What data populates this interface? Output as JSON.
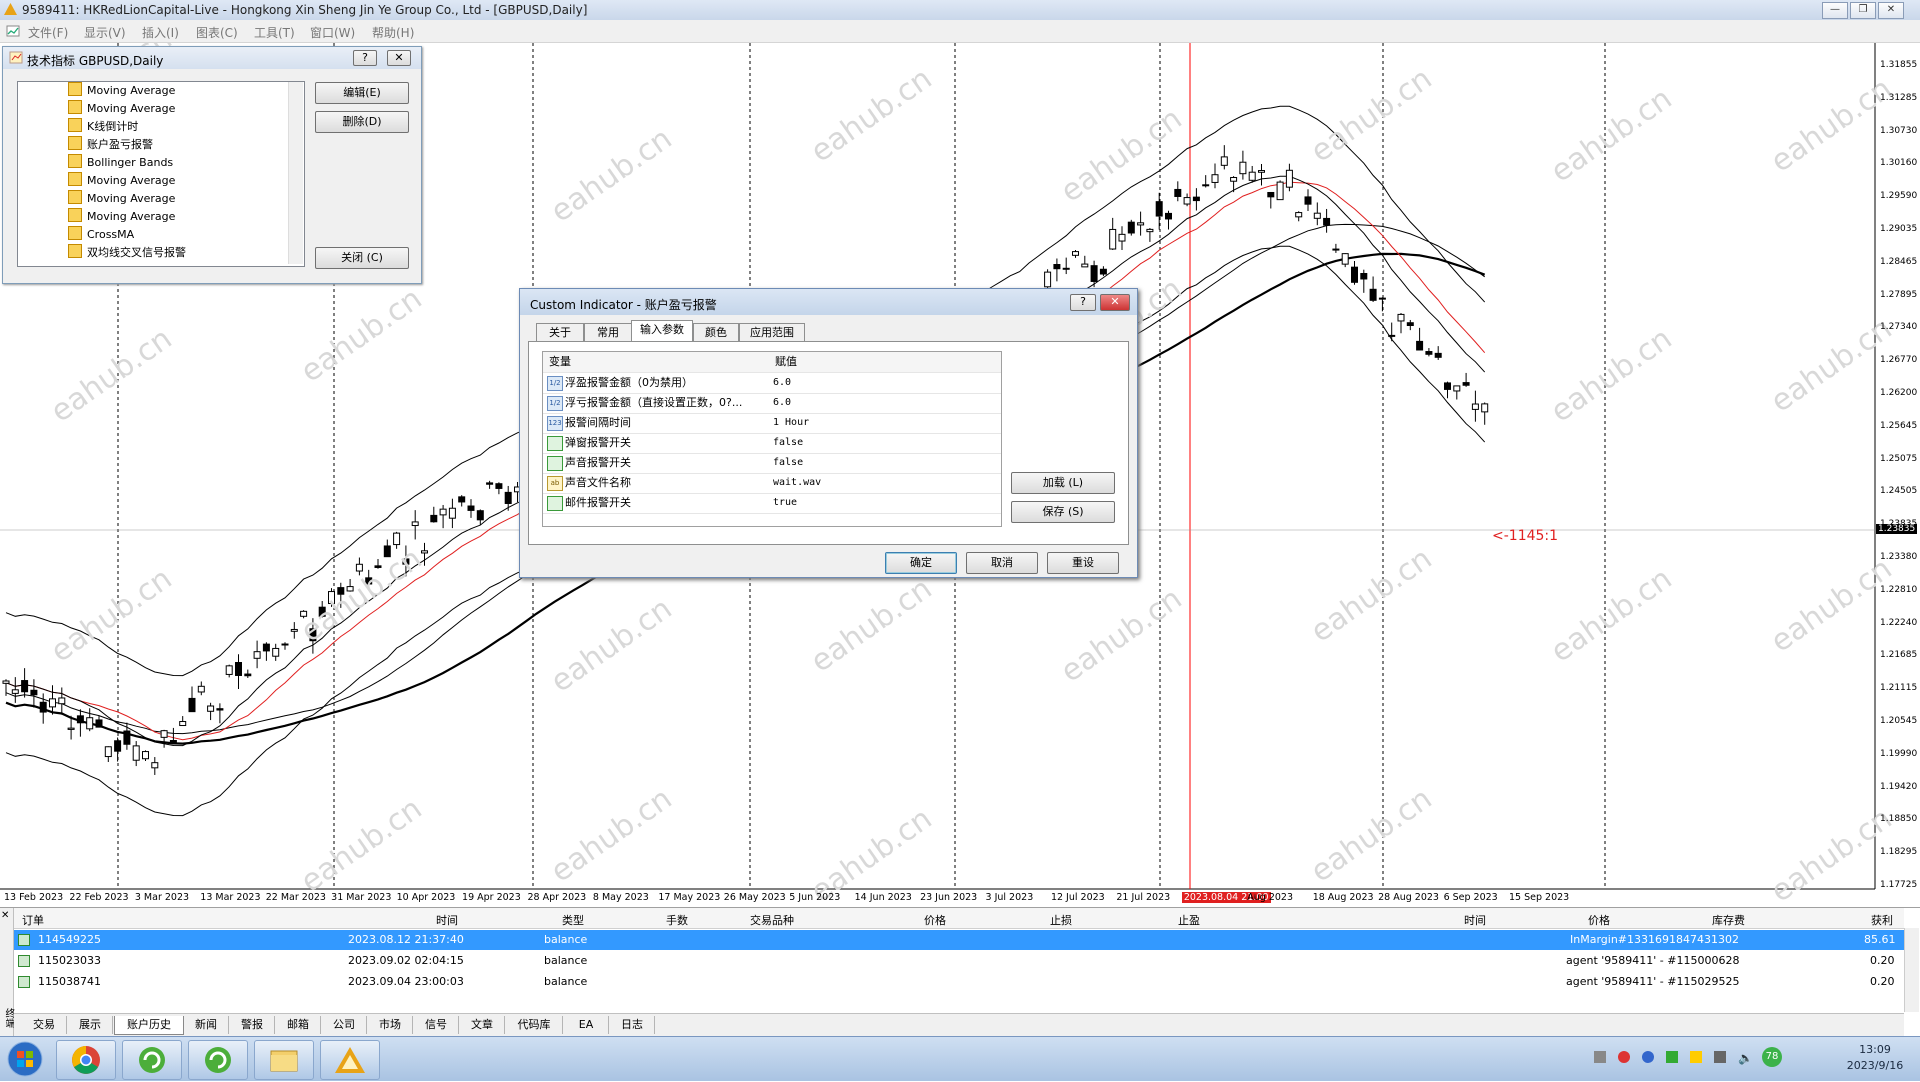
{
  "window": {
    "title": "9589411: HKRedLionCapital-Live - Hongkong Xin Sheng Jin Ye Group Co., Ltd - [GBPUSD,Daily]",
    "menu": [
      "文件(F)",
      "显示(V)",
      "插入(I)",
      "图表(C)",
      "工具(T)",
      "窗口(W)",
      "帮助(H)"
    ]
  },
  "indicators_panel": {
    "title": "技术指标 GBPUSD,Daily",
    "items": [
      "Moving Average",
      "Moving Average",
      "K线倒计时",
      "账户盈亏报警",
      "Bollinger Bands",
      "Moving Average",
      "Moving Average",
      "Moving Average",
      "CrossMA",
      "双均线交叉信号报警"
    ],
    "buttons": {
      "edit": "编辑(E)",
      "delete": "删除(D)",
      "close": "关闭 (C)"
    }
  },
  "dialog": {
    "title": "Custom Indicator - 账户盈亏报警",
    "tabs": [
      "关于",
      "常用",
      "输入参数",
      "颜色",
      "应用范围"
    ],
    "active_tab": "输入参数",
    "columns": [
      "变量",
      "赋值"
    ],
    "params": [
      {
        "type": "1/2",
        "name": "浮盈报警金额（0为禁用）",
        "value": "6.0"
      },
      {
        "type": "1/2",
        "name": "浮亏报警金额（直接设置正数，0?...",
        "value": "6.0"
      },
      {
        "type": "123",
        "name": "报警间隔时间",
        "value": "1 Hour"
      },
      {
        "type": "bool",
        "name": "弹窗报警开关",
        "value": "false"
      },
      {
        "type": "bool",
        "name": "声音报警开关",
        "value": "false"
      },
      {
        "type": "ab",
        "name": "声音文件名称",
        "value": "wait.wav"
      },
      {
        "type": "bool",
        "name": "邮件报警开关",
        "value": "true"
      }
    ],
    "buttons": {
      "load": "加载 (L)",
      "save": "保存 (S)",
      "ok": "确定",
      "cancel": "取消",
      "reset": "重设"
    }
  },
  "chart": {
    "symbol": "GBPUSD,Daily",
    "price_labels": [
      "1.31855",
      "1.31285",
      "1.30730",
      "1.30160",
      "1.29590",
      "1.29035",
      "1.28465",
      "1.27895",
      "1.27340",
      "1.26770",
      "1.26200",
      "1.25645",
      "1.25075",
      "1.24505",
      "1.23835",
      "1.23380",
      "1.22810",
      "1.22240",
      "1.21685",
      "1.21115",
      "1.20545",
      "1.19990",
      "1.19420",
      "1.18850",
      "1.18295",
      "1.17725"
    ],
    "current_price": "1.23835",
    "countdown_label": "<-1145:1",
    "date_labels": [
      "13 Feb 2023",
      "22 Feb 2023",
      "3 Mar 2023",
      "13 Mar 2023",
      "22 Mar 2023",
      "31 Mar 2023",
      "10 Apr 2023",
      "19 Apr 2023",
      "28 Apr 2023",
      "8 May 2023",
      "17 May 2023",
      "26 May 2023",
      "5 Jun 2023",
      "14 Jun 2023",
      "23 Jun 2023",
      "3 Jul 2023",
      "12 Jul 2023",
      "21 Jul 2023",
      "2023.08.04 21:00",
      "Aug 2023",
      "18 Aug 2023",
      "28 Aug 2023",
      "6 Sep 2023",
      "15 Sep 2023"
    ],
    "colors": {
      "bull": "#ffffff",
      "bear": "#000000",
      "ma_red": "#e02020",
      "crosshair": "#ff0000",
      "watermark": "#d8d8d8"
    },
    "watermark_text": "eahub.cn"
  },
  "terminal": {
    "headers": [
      "订单",
      "时间",
      "类型",
      "手数",
      "交易品种",
      "价格",
      "止损",
      "止盈",
      "时间",
      "价格",
      "库存费",
      "获利"
    ],
    "rows": [
      {
        "order": "114549225",
        "time": "2023.08.12 21:37:40",
        "type": "balance",
        "comment": "InMargin#1331691847431302",
        "profit": "85.61"
      },
      {
        "order": "115023033",
        "time": "2023.09.02 02:04:15",
        "type": "balance",
        "comment": "agent '9589411' - #115000628",
        "profit": "0.20"
      },
      {
        "order": "115038741",
        "time": "2023.09.04 23:00:03",
        "type": "balance",
        "comment": "agent '9589411' - #115029525",
        "profit": "0.20"
      }
    ],
    "tabs": [
      "交易",
      "展示",
      "账户历史",
      "新闻",
      "警报",
      "邮箱",
      "公司",
      "市场",
      "信号",
      "文章",
      "代码库",
      "EA",
      "日志"
    ],
    "active_tab": "账户历史",
    "side_label": "终端"
  },
  "taskbar": {
    "time": "13:09",
    "date": "2023/9/16",
    "badge": "78"
  }
}
